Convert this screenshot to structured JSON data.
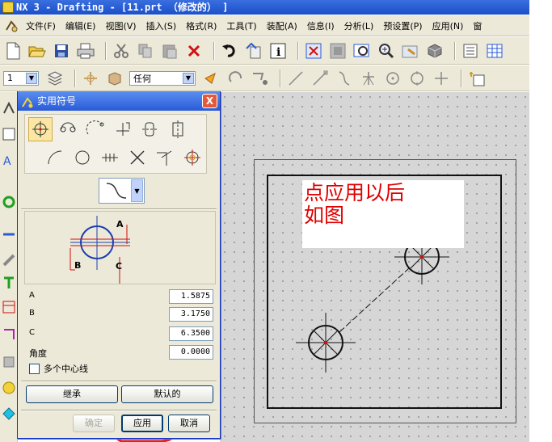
{
  "window": {
    "title": "NX 3 - Drafting - [11.prt （修改的） ]"
  },
  "menu": {
    "items": [
      "文件(F)",
      "编辑(E)",
      "视图(V)",
      "插入(S)",
      "格式(R)",
      "工具(T)",
      "装配(A)",
      "信息(I)",
      "分析(L)",
      "预设置(P)",
      "应用(N)",
      "窗"
    ]
  },
  "toolbar2": {
    "layer_value": "1",
    "filter_value": "任何"
  },
  "dialog": {
    "title": "实用符号",
    "close_label": "X",
    "params": {
      "a_label": "A",
      "a_value": "1.5875",
      "b_label": "B",
      "b_value": "3.1750",
      "c_label": "C",
      "c_value": "6.3500",
      "angle_label": "角度",
      "angle_value": "0.0000"
    },
    "multi_centerline_label": "多个中心线",
    "multi_centerline_checked": false,
    "inherit_label": "继承",
    "default_label": "默认的",
    "ok_label": "确定",
    "apply_label": "应用",
    "cancel_label": "取消",
    "preview_labels": {
      "a": "A",
      "b": "B",
      "c": "C"
    }
  },
  "annotation": {
    "line1": "点应用以后",
    "line2": "如图",
    "color": "#e00000"
  },
  "colors": {
    "title_bar": "#2a5bd7",
    "highlight_circle": "#e02020",
    "preview_symbol": "#1a3fb0"
  }
}
